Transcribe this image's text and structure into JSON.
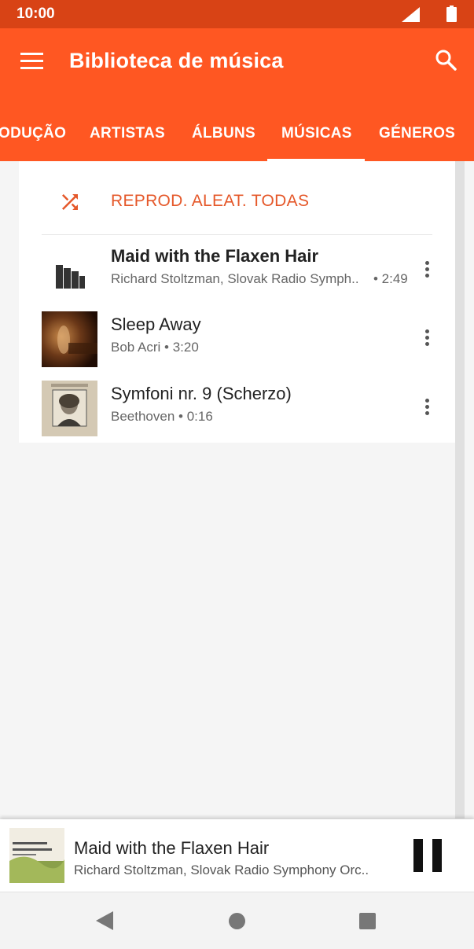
{
  "status_bar": {
    "time": "10:00",
    "signal_icon": "signal-icon",
    "battery_icon": "battery-icon"
  },
  "app_bar": {
    "title": "Biblioteca de música",
    "menu_icon": "hamburger-menu-icon",
    "search_icon": "search-icon"
  },
  "tabs": {
    "items": [
      {
        "label": "ODUÇÃO"
      },
      {
        "label": "ARTISTAS"
      },
      {
        "label": "ÁLBUNS"
      },
      {
        "label": "MÚSICAS"
      },
      {
        "label": "GÉNEROS"
      }
    ],
    "selected": "MÚSICAS"
  },
  "shuffle": {
    "label": "REPROD. ALEAT. TODAS",
    "icon": "shuffle-icon"
  },
  "songs": [
    {
      "title": "Maid with the Flaxen Hair",
      "subtitle": "Richard Stoltzman, Slovak Radio Symph..",
      "duration": "• 2:49",
      "playing": true,
      "art": "now-playing-bars-icon"
    },
    {
      "title": "Sleep Away",
      "subtitle": "Bob Acri • 3:20",
      "art": "album-art-sleep-away"
    },
    {
      "title": "Symfoni nr. 9 (Scherzo)",
      "subtitle": "Beethoven • 0:16",
      "art": "album-art-beethoven"
    }
  ],
  "mini_player": {
    "title": "Maid with the Flaxen Hair",
    "subtitle": "Richard Stoltzman, Slovak Radio Symphony Orc..",
    "pause_icon": "pause-icon"
  },
  "colors": {
    "status_bar": "#d84315",
    "app_bar": "#ff5722",
    "accent": "#e5582a"
  }
}
